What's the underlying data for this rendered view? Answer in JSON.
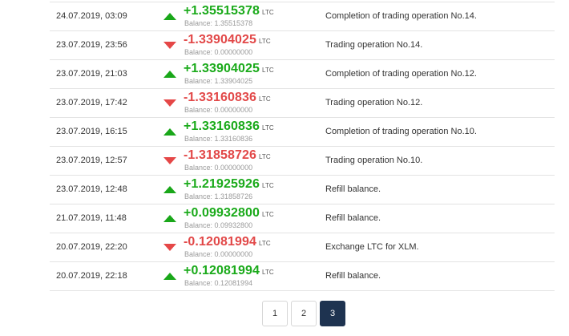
{
  "transactions": [
    {
      "date": "24.07.2019, 03:09",
      "direction": "up",
      "amount": "+1.35515378",
      "currency": "LTC",
      "balance": "Balance: 1.35515378",
      "description": "Completion of trading operation No.14."
    },
    {
      "date": "23.07.2019, 23:56",
      "direction": "down",
      "amount": "-1.33904025",
      "currency": "LTC",
      "balance": "Balance: 0.00000000",
      "description": "Trading operation No.14."
    },
    {
      "date": "23.07.2019, 21:03",
      "direction": "up",
      "amount": "+1.33904025",
      "currency": "LTC",
      "balance": "Balance: 1.33904025",
      "description": "Completion of trading operation No.12."
    },
    {
      "date": "23.07.2019, 17:42",
      "direction": "down",
      "amount": "-1.33160836",
      "currency": "LTC",
      "balance": "Balance: 0.00000000",
      "description": "Trading operation No.12."
    },
    {
      "date": "23.07.2019, 16:15",
      "direction": "up",
      "amount": "+1.33160836",
      "currency": "LTC",
      "balance": "Balance: 1.33160836",
      "description": "Completion of trading operation No.10."
    },
    {
      "date": "23.07.2019, 12:57",
      "direction": "down",
      "amount": "-1.31858726",
      "currency": "LTC",
      "balance": "Balance: 0.00000000",
      "description": "Trading operation No.10."
    },
    {
      "date": "23.07.2019, 12:48",
      "direction": "up",
      "amount": "+1.21925926",
      "currency": "LTC",
      "balance": "Balance: 1.31858726",
      "description": "Refill balance."
    },
    {
      "date": "21.07.2019, 11:48",
      "direction": "up",
      "amount": "+0.09932800",
      "currency": "LTC",
      "balance": "Balance: 0.09932800",
      "description": "Refill balance."
    },
    {
      "date": "20.07.2019, 22:20",
      "direction": "down",
      "amount": "-0.12081994",
      "currency": "LTC",
      "balance": "Balance: 0.00000000",
      "description": "Exchange LTC for XLM."
    },
    {
      "date": "20.07.2019, 22:18",
      "direction": "up",
      "amount": "+0.12081994",
      "currency": "LTC",
      "balance": "Balance: 0.12081994",
      "description": "Refill balance."
    }
  ],
  "colors": {
    "positive": "#1aaa1a",
    "negative": "#e24848",
    "active_page": "#1e3350"
  },
  "pagination": {
    "pages": [
      "1",
      "2",
      "3"
    ],
    "active": "3"
  }
}
